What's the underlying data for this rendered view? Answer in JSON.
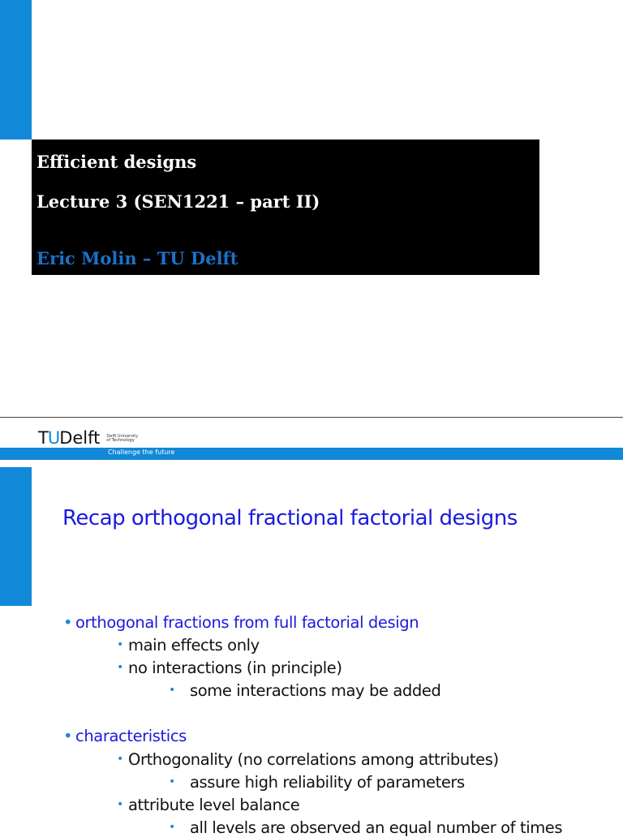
{
  "cover": {
    "title": "Efficient designs",
    "subtitle": "Lecture 3 (SEN1221 – part II)",
    "author": "Eric Molin – TU Delft"
  },
  "header": {
    "logo_text": "TUDelft",
    "logo_small": "Delft University of Technology",
    "tagline": "Challenge the future"
  },
  "slide": {
    "title": "Recap orthogonal fractional factorial designs",
    "bullets": [
      {
        "level": 1,
        "text": "orthogonal fractions from full factorial design"
      },
      {
        "level": 2,
        "text": "main effects only"
      },
      {
        "level": 2,
        "text": "no interactions (in principle)"
      },
      {
        "level": 3,
        "text": "some interactions may be added"
      },
      {
        "level": 1,
        "text": "characteristics"
      },
      {
        "level": 2,
        "text": "Orthogonality (no correlations among attributes)"
      },
      {
        "level": 3,
        "text": "assure high reliability of parameters"
      },
      {
        "level": 2,
        "text": "attribute level balance"
      },
      {
        "level": 3,
        "text": "all levels are observed an equal number of times"
      }
    ]
  },
  "colors": {
    "accent": "#1188d8",
    "title_blue": "#1a1ae0",
    "author_blue": "#1a72c8"
  }
}
